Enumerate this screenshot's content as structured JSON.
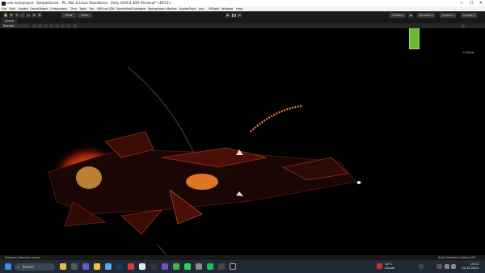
{
  "window": {
    "title": "new mainproject - SampleScene - PC, Mac & Linux Standalone - Unity 2019.4.30f1 Personal* <DX11>",
    "controls": [
      "—",
      "☐",
      "✕"
    ]
  },
  "menu": [
    "File",
    "Edit",
    "Assets",
    "GameObject",
    "Component",
    "Thry",
    "Tools",
    "Poi",
    "VRChat SDK",
    "SketchfabS",
    "Ashbone",
    "Youngsimon",
    "Mochie",
    "AvatarTools",
    "Jolo",
    "VRLabs",
    "Window",
    "Help"
  ],
  "toolbar": {
    "pivot": "Pivot",
    "local": "Local",
    "collab": "Collab ▾",
    "account": "Account ▾",
    "layers": "Layers ▾",
    "layout": "Layout ▾"
  },
  "scene_tab": "Scene",
  "scene_bar": {
    "shading_mode": "Shaded"
  },
  "viewport": {
    "perspective_label": "< Persp",
    "accent_color": "#6fb834"
  },
  "status": {
    "left": "[Arktown] Remote version",
    "right": "Auto Generate Lighting Off"
  },
  "taskbar": {
    "search_placeholder": "Search",
    "weather_temp": "14°C",
    "weather_desc": "Cloudy",
    "time": "15:53",
    "date": "24.10.2024"
  }
}
